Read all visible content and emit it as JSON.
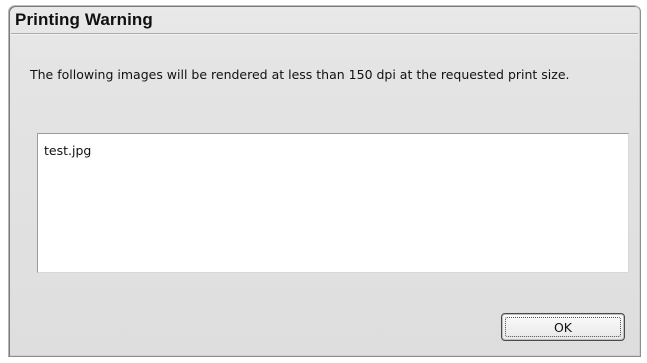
{
  "dialog": {
    "title": "Printing Warning",
    "message": "The following images will be rendered at less than 150 dpi at the requested print size.",
    "files": [
      "test.jpg"
    ],
    "ok_label": "OK"
  }
}
